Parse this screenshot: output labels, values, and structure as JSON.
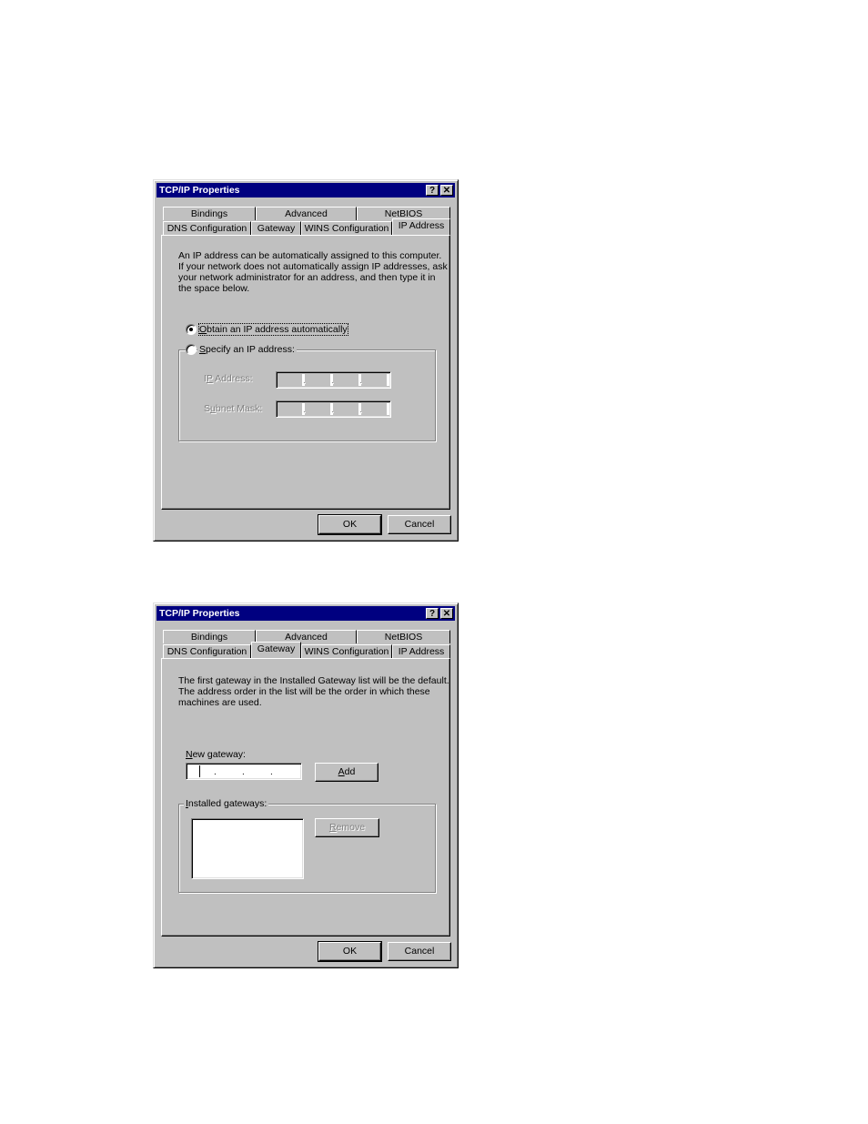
{
  "dialogs": [
    {
      "title": "TCP/IP Properties",
      "help_button": "?",
      "close_button": "✕",
      "tabs_row1": [
        "Bindings",
        "Advanced",
        "NetBIOS"
      ],
      "tabs_row2": [
        "DNS Configuration",
        "Gateway",
        "WINS Configuration",
        "IP Address"
      ],
      "active_tab": "IP Address",
      "description": [
        "An IP address can be automatically assigned to this computer.",
        "If your network does not automatically assign IP addresses, ask",
        "your network administrator for an address, and then type it in",
        "the space below."
      ],
      "radio_obtain": {
        "label_mnemonic": "O",
        "label_rest": "btain an IP address automatically",
        "selected": true
      },
      "radio_specify": {
        "label_mnemonic": "S",
        "label_rest": "pecify an IP address:",
        "selected": false
      },
      "ip_address": {
        "label_pre": "I",
        "label_mnemonic": "P",
        "label_rest": " Address:",
        "value": "",
        "enabled": false
      },
      "subnet_mask": {
        "label_pre": "S",
        "label_mnemonic": "u",
        "label_rest": "bnet Mask:",
        "value": "",
        "enabled": false
      },
      "ip_separator": ".",
      "ok_label": "OK",
      "cancel_label": "Cancel"
    },
    {
      "title": "TCP/IP Properties",
      "help_button": "?",
      "close_button": "✕",
      "tabs_row1": [
        "Bindings",
        "Advanced",
        "NetBIOS"
      ],
      "tabs_row2": [
        "DNS Configuration",
        "Gateway",
        "WINS Configuration",
        "IP Address"
      ],
      "active_tab": "Gateway",
      "description": [
        "The first gateway in the Installed Gateway list will be the default.",
        "The address order in the list will be the order in which these",
        "machines are used."
      ],
      "new_gateway": {
        "label_mnemonic": "N",
        "label_rest": "ew gateway:",
        "value": ""
      },
      "add_button": {
        "label_mnemonic": "A",
        "label_rest": "dd"
      },
      "installed_gateways": {
        "label_mnemonic": "I",
        "label_rest": "nstalled gateways:",
        "items": []
      },
      "remove_button": {
        "label_mnemonic": "R",
        "label_rest": "emove",
        "enabled": false
      },
      "ip_separator": ".",
      "ok_label": "OK",
      "cancel_label": "Cancel"
    }
  ]
}
